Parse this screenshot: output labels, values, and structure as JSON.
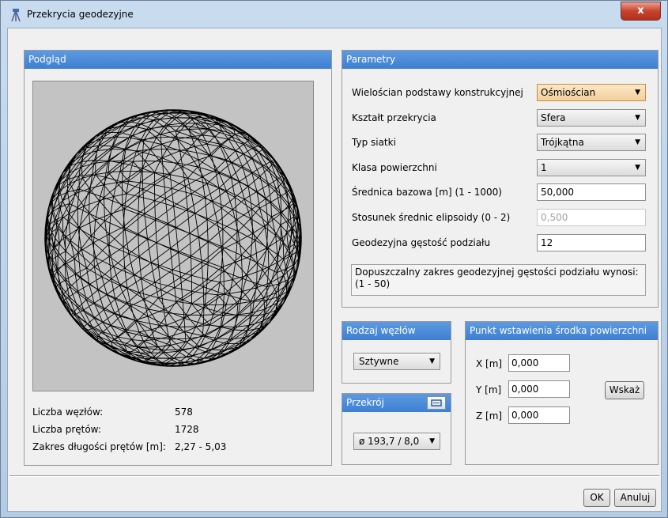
{
  "window": {
    "title": "Przekrycia geodezyjne",
    "close_label": "x"
  },
  "preview": {
    "header": "Podgląd",
    "stats": [
      {
        "label": "Liczba węzłów:",
        "value": "578"
      },
      {
        "label": "Liczba prętów:",
        "value": "1728"
      },
      {
        "label": "Zakres długości prętów [m]:",
        "value": "2,27 - 5,03"
      }
    ]
  },
  "parameters": {
    "header": "Parametry",
    "rows": [
      {
        "label": "Wielościan podstawy konstrukcyjnej",
        "value": "Ośmiościan",
        "kind": "select"
      },
      {
        "label": "Kształt przekrycia",
        "value": "Sfera",
        "kind": "select"
      },
      {
        "label": "Typ siatki",
        "value": "Trójkątna",
        "kind": "select"
      },
      {
        "label": "Klasa powierzchni",
        "value": "1",
        "kind": "select"
      },
      {
        "label": "Średnica bazowa [m] (1 - 1000)",
        "value": "50,000",
        "kind": "input"
      },
      {
        "label": "Stosunek średnic elipsoidy (0 - 2)",
        "value": "0,500",
        "kind": "input-disabled"
      },
      {
        "label": "Geodezyjna gęstość podziału",
        "value": "12",
        "kind": "input"
      }
    ],
    "info": "Dopuszczalny zakres geodezyjnej gęstości podziału wynosi: (1 - 50)"
  },
  "nodes": {
    "header": "Rodzaj węzłów",
    "value": "Sztywne"
  },
  "section": {
    "header": "Przekrój",
    "value": "ø 193,7 / 8,0"
  },
  "insertion": {
    "header": "Punkt wstawienia środka powierzchni",
    "x_label": "X [m]",
    "x_value": "0,000",
    "y_label": "Y [m]",
    "y_value": "0,000",
    "z_label": "Z [m]",
    "z_value": "0,000",
    "pick_label": "Wskaż"
  },
  "footer": {
    "ok_label": "OK",
    "cancel_label": "Anuluj"
  },
  "icons": {
    "app": "surveyor-icon",
    "section_edit": "edit-section-icon"
  },
  "colors": {
    "header_blue": "#3d7fd2",
    "preview_bg": "#c3c3c3",
    "close_red": "#c8432e"
  }
}
